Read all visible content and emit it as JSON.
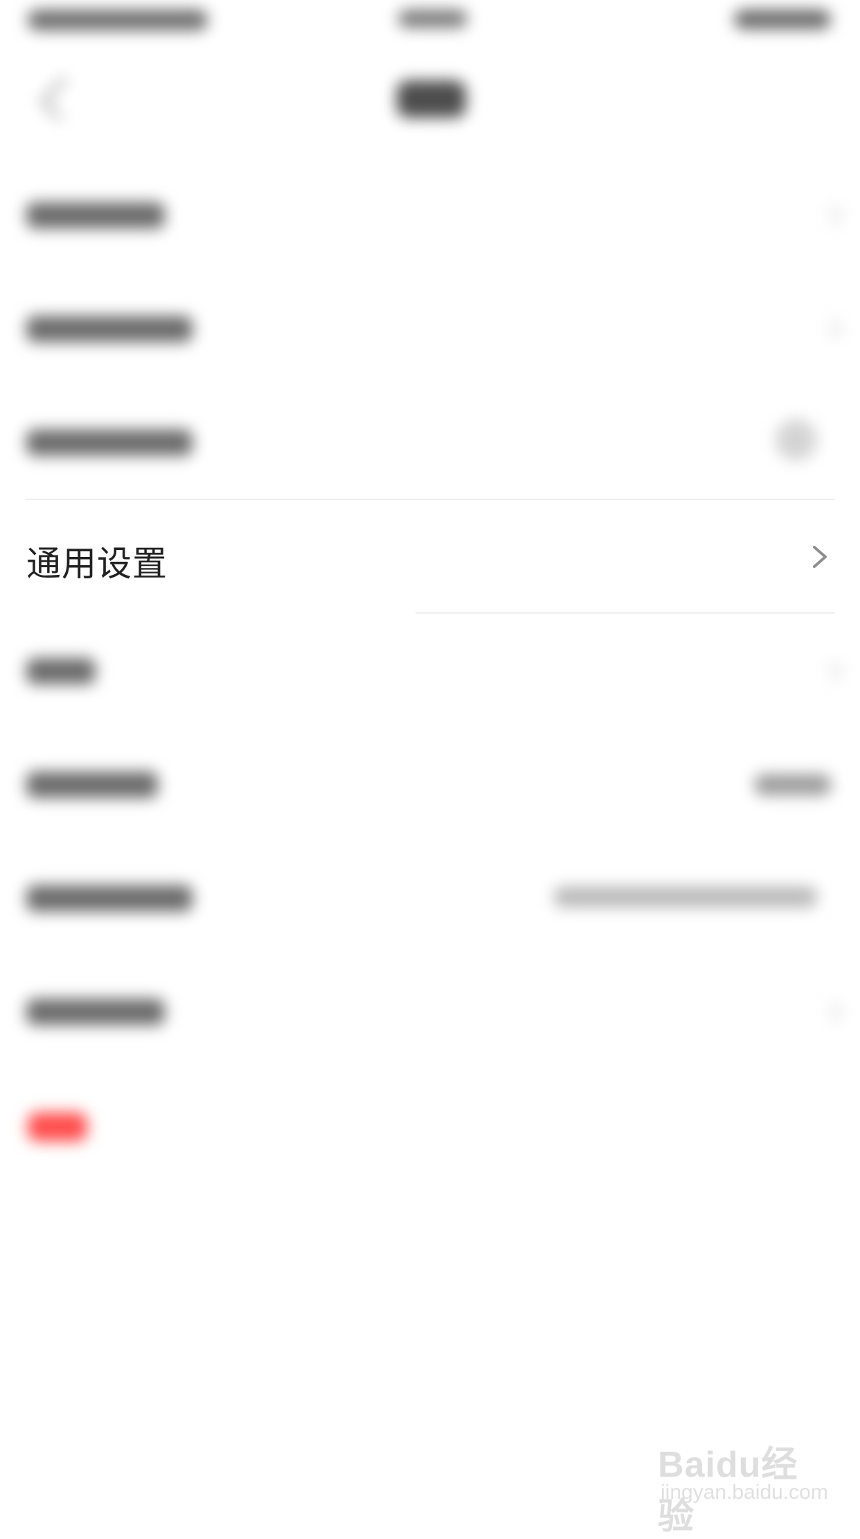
{
  "settings": {
    "general_settings_label": "通用设置"
  },
  "icons": {
    "chevron": "chevron-right-icon"
  },
  "colors": {
    "text_primary": "#222222",
    "chevron": "#8e8e8e",
    "logout_accent": "#ff4d4d",
    "background": "#ffffff"
  },
  "watermark": {
    "brand": "Baidu经验",
    "url": "jingyan.baidu.com"
  }
}
